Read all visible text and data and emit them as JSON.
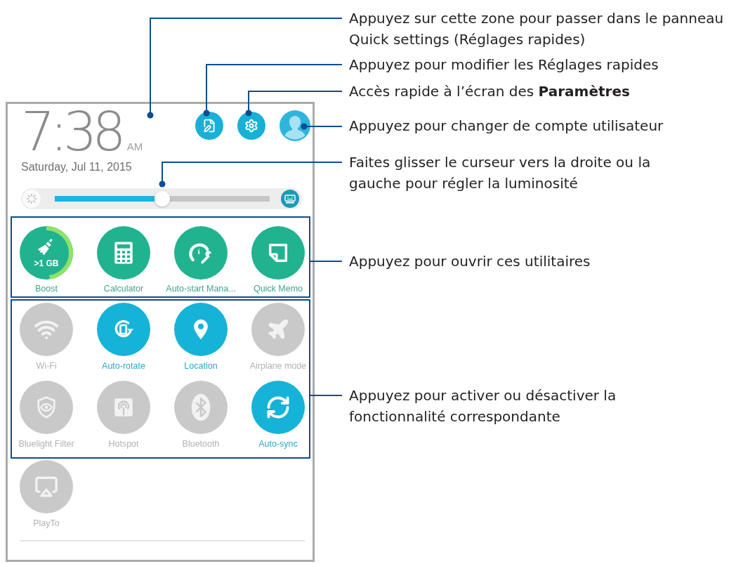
{
  "panel": {
    "clock": {
      "time": "7:38",
      "meridiem": "AM"
    },
    "date": "Saturday, Jul 11, 2015",
    "brightness": {
      "level": 0.5
    },
    "utilities": [
      {
        "label": "Boost",
        "badge": ">1 GB",
        "level": 0.48
      },
      {
        "label": "Calculator"
      },
      {
        "label": "Auto-start Mana..."
      },
      {
        "label": "Quick Memo"
      }
    ],
    "toggles": [
      {
        "label": "Wi-Fi",
        "on": false
      },
      {
        "label": "Auto-rotate",
        "on": true
      },
      {
        "label": "Location",
        "on": true
      },
      {
        "label": "Airplane mode",
        "on": false
      },
      {
        "label": "Bluelight Filter",
        "on": false
      },
      {
        "label": "Hotspot",
        "on": false
      },
      {
        "label": "Bluetooth",
        "on": false
      },
      {
        "label": "Auto-sync",
        "on": true
      }
    ],
    "more_toggles": [
      {
        "label": "PlayTo",
        "on": false
      }
    ]
  },
  "callouts": [
    {
      "lines": [
        "Appuyez sur cette zone pour passer dans le panneau",
        "Quick settings (Réglages rapides)"
      ]
    },
    {
      "lines": [
        "Appuyez pour modifier les Réglages rapides"
      ]
    },
    {
      "lines": [
        "Accès rapide à l’écran des **Paramètres**"
      ]
    },
    {
      "lines": [
        "Appuyez pour changer de compte utilisateur"
      ]
    },
    {
      "lines": [
        "Faites glisser le curseur vers la droite ou la",
        "gauche pour régler la luminosité"
      ]
    },
    {
      "lines": [
        "Appuyez pour ouvrir ces utilitaires"
      ]
    },
    {
      "lines": [
        "Appuyez pour activer ou désactiver la",
        "fonctionnalité correspondante"
      ]
    }
  ]
}
